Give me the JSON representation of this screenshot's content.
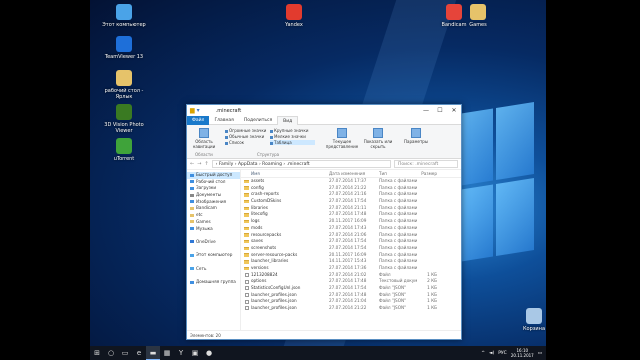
{
  "desktop": {
    "icons": [
      {
        "label": "Этот компьютер",
        "icon": "computer-icon",
        "color": "#4aa3e8"
      },
      {
        "label": "TeamViewer 13",
        "icon": "teamviewer-icon",
        "color": "#1e6fd9"
      },
      {
        "label": "рабочий стол - Ярлык",
        "icon": "shortcut-icon",
        "color": "#e6c36a"
      },
      {
        "label": "3D Vision Photo Viewer",
        "icon": "3d-vision-icon",
        "color": "#3a7a22"
      },
      {
        "label": "uTorrent",
        "icon": "utorrent-icon",
        "color": "#3fa33a"
      },
      {
        "label": "Yandex",
        "icon": "yandex-icon",
        "color": "#e23b2e"
      },
      {
        "label": "Bandicam",
        "icon": "bandicam-icon",
        "color": "#e6443a"
      },
      {
        "label": "Games",
        "icon": "folder-icon",
        "color": "#e6c36a"
      },
      {
        "label": "Корзина",
        "icon": "recycle-bin-icon",
        "color": "#a9c8e6"
      }
    ]
  },
  "explorer": {
    "title": ".minecraft",
    "window_buttons": [
      "—",
      "☐",
      "✕"
    ],
    "tabs": [
      "Файл",
      "Главная",
      "Поделиться",
      "Вид"
    ],
    "ribbon": {
      "pane_button": "Область навигации",
      "pane_group": "Области",
      "layout_options": [
        "Огромные значки",
        "Крупные значки",
        "Обычные значки",
        "Мелкие значки",
        "Список",
        "Таблица"
      ],
      "layout_group": "Структура",
      "sort_button": "Текущее представление",
      "show_button": "Показать или скрыть",
      "params_button": "Параметры"
    },
    "address": {
      "path": "›  Family  ›  AppData  ›  Roaming  ›  .minecraft",
      "search_placeholder": "Поиск: .minecraft"
    },
    "nav_items": [
      {
        "label": "Быстрый доступ",
        "icon": "star-icon",
        "color": "#3f8fe0",
        "selected": true
      },
      {
        "label": "Рабочий стол",
        "icon": "desktop-icon",
        "color": "#3f8fe0"
      },
      {
        "label": "Загрузки",
        "icon": "download-icon",
        "color": "#3f8fe0"
      },
      {
        "label": "Документы",
        "icon": "documents-icon",
        "color": "#888"
      },
      {
        "label": "Изображения",
        "icon": "pictures-icon",
        "color": "#3f8fe0"
      },
      {
        "label": "Bandicam",
        "icon": "folder-icon",
        "color": "#e6c36a"
      },
      {
        "label": "etc",
        "icon": "folder-icon",
        "color": "#e6c36a"
      },
      {
        "label": "Games",
        "icon": "folder-icon",
        "color": "#e6c36a"
      },
      {
        "label": "Музыка",
        "icon": "music-icon",
        "color": "#3f8fe0"
      },
      {
        "label": "",
        "icon": "",
        "color": ""
      },
      {
        "label": "OneDrive",
        "icon": "onedrive-icon",
        "color": "#2f78d6"
      },
      {
        "label": "",
        "icon": "",
        "color": ""
      },
      {
        "label": "Этот компьютер",
        "icon": "computer-icon",
        "color": "#4aa3e8"
      },
      {
        "label": "",
        "icon": "",
        "color": ""
      },
      {
        "label": "Сеть",
        "icon": "network-icon",
        "color": "#4aa3e8"
      },
      {
        "label": "",
        "icon": "",
        "color": ""
      },
      {
        "label": "Домашняя группа",
        "icon": "homegroup-icon",
        "color": "#3f8fe0"
      }
    ],
    "columns": [
      "Имя",
      "Дата изменения",
      "Тип",
      "Размер"
    ],
    "files": [
      {
        "name": "assets",
        "date": "27.07.2014 17:37",
        "type": "Папка с файлами",
        "size": "",
        "kind": "folder"
      },
      {
        "name": "config",
        "date": "27.07.2014 21:22",
        "type": "Папка с файлами",
        "size": "",
        "kind": "folder"
      },
      {
        "name": "crash-reports",
        "date": "27.07.2014 21:16",
        "type": "Папка с файлами",
        "size": "",
        "kind": "folder"
      },
      {
        "name": "CustomDSkins",
        "date": "27.07.2014 17:54",
        "type": "Папка с файлами",
        "size": "",
        "kind": "folder"
      },
      {
        "name": "libraries",
        "date": "27.07.2014 21:11",
        "type": "Папка с файлами",
        "size": "",
        "kind": "folder"
      },
      {
        "name": "litecofig",
        "date": "27.07.2014 17:48",
        "type": "Папка с файлами",
        "size": "",
        "kind": "folder"
      },
      {
        "name": "logs",
        "date": "20.11.2017 16:09",
        "type": "Папка с файлами",
        "size": "",
        "kind": "folder"
      },
      {
        "name": "mods",
        "date": "27.07.2014 17:43",
        "type": "Папка с файлами",
        "size": "",
        "kind": "folder"
      },
      {
        "name": "resourcepacks",
        "date": "27.07.2014 21:06",
        "type": "Папка с файлами",
        "size": "",
        "kind": "folder"
      },
      {
        "name": "saves",
        "date": "27.07.2014 17:54",
        "type": "Папка с файлами",
        "size": "",
        "kind": "folder"
      },
      {
        "name": "screenshots",
        "date": "27.07.2014 17:54",
        "type": "Папка с файлами",
        "size": "",
        "kind": "folder"
      },
      {
        "name": "server-resource-packs",
        "date": "20.11.2017 16:09",
        "type": "Папка с файлами",
        "size": "",
        "kind": "folder"
      },
      {
        "name": "launcher_libraries",
        "date": "14.11.2017 15:43",
        "type": "Папка с файлами",
        "size": "",
        "kind": "folder"
      },
      {
        "name": "versions",
        "date": "27.07.2014 17:36",
        "type": "Папка с файлами",
        "size": "",
        "kind": "folder"
      },
      {
        "name": "1213208824",
        "date": "27.07.2014 21:02",
        "type": "Файл",
        "size": "1 КБ",
        "kind": "file"
      },
      {
        "name": "options",
        "date": "27.07.2014 17:48",
        "type": "Текстовый докум...",
        "size": "2 КБ",
        "kind": "file"
      },
      {
        "name": "StatisticsConfigUnl.json",
        "date": "27.07.2014 17:54",
        "type": "Файл \"JSON\"",
        "size": "1 КБ",
        "kind": "file"
      },
      {
        "name": "launcher_profiles.json",
        "date": "27.07.2014 17:48",
        "type": "Файл \"JSON\"",
        "size": "1 КБ",
        "kind": "file"
      },
      {
        "name": "launcher_profiles.json",
        "date": "27.07.2014 21:04",
        "type": "Файл \"JSON\"",
        "size": "1 КБ",
        "kind": "file"
      },
      {
        "name": "launcher_profiles.json",
        "date": "27.07.2014 21:22",
        "type": "Файл \"JSON\"",
        "size": "1 КБ",
        "kind": "file"
      }
    ],
    "status": "Элементов: 20"
  },
  "taskbar": {
    "items": [
      {
        "icon": "start-icon",
        "glyph": "⊞"
      },
      {
        "icon": "search-icon",
        "glyph": "○"
      },
      {
        "icon": "task-view-icon",
        "glyph": "▭"
      },
      {
        "icon": "edge-icon",
        "glyph": "e"
      },
      {
        "icon": "explorer-icon",
        "glyph": "▬",
        "active": true
      },
      {
        "icon": "store-icon",
        "glyph": "▦"
      },
      {
        "icon": "yandex-icon",
        "glyph": "Y"
      },
      {
        "icon": "app-icon",
        "glyph": "▣"
      },
      {
        "icon": "bandicam-icon",
        "glyph": "●"
      }
    ],
    "tray_lang": "РУС",
    "time": "16:10",
    "date": "20.11.2017"
  }
}
